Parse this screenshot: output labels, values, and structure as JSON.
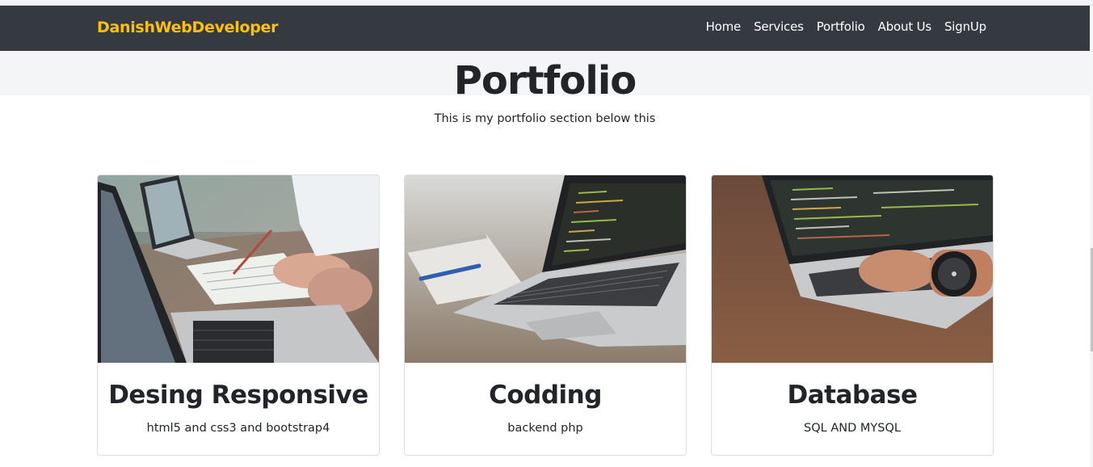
{
  "navbar": {
    "brand": "DanishWebDeveloper",
    "links": [
      "Home",
      "Services",
      "Portfolio",
      "About Us",
      "SignUp"
    ]
  },
  "hero": {
    "title": "Portfolio",
    "subtitle": "This is my portfolio section below this"
  },
  "cards": [
    {
      "title": "Desing Responsive",
      "text": "html5 and css3 and bootstrap4",
      "image_icon": "laptop-meeting-photo"
    },
    {
      "title": "Codding",
      "text": "backend php",
      "image_icon": "laptop-notebook-photo"
    },
    {
      "title": "Database",
      "text": "SQL AND MYSQL",
      "image_icon": "laptop-typing-photo"
    }
  ],
  "colors": {
    "navbar_bg": "#343a40",
    "brand": "#ffc107",
    "hero_bg": "#f4f5f7"
  }
}
